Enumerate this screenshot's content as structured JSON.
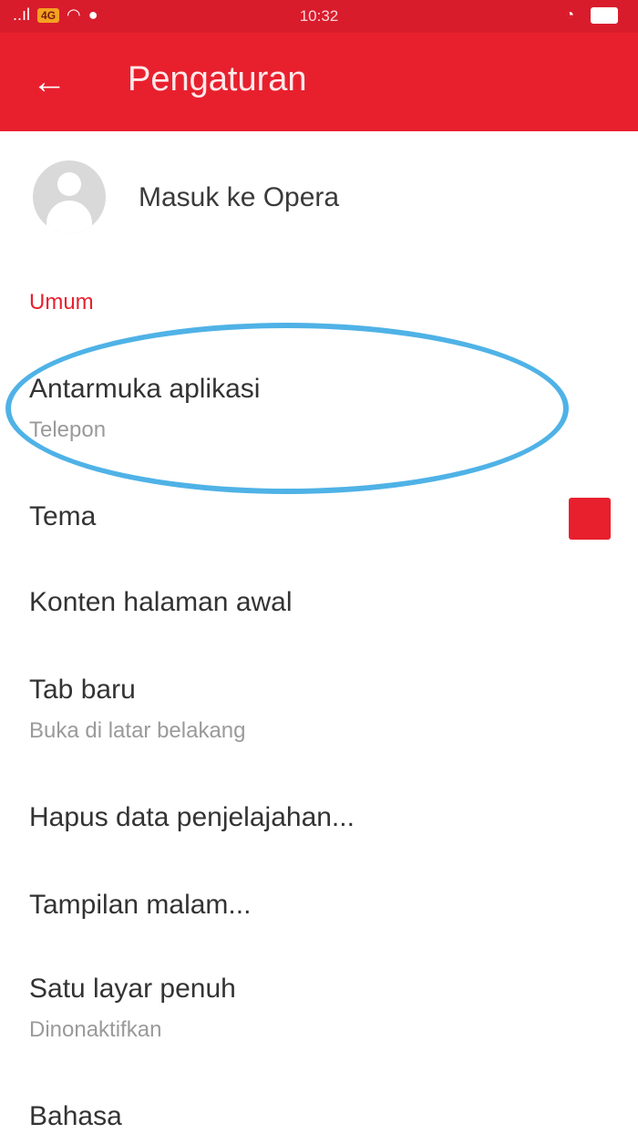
{
  "status_bar": {
    "signal": "..ıl",
    "badge": "4G",
    "time": "10:32"
  },
  "app_bar": {
    "back_glyph": "←",
    "title": "Pengaturan"
  },
  "account": {
    "label": "Masuk ke Opera"
  },
  "section": {
    "header": "Umum"
  },
  "settings": [
    {
      "title": "Antarmuka aplikasi",
      "subtitle": "Telepon"
    },
    {
      "title": "Tema"
    },
    {
      "title": "Konten halaman awal"
    },
    {
      "title": "Tab baru",
      "subtitle": "Buka di latar belakang"
    },
    {
      "title": "Hapus data penjelajahan..."
    },
    {
      "title": "Tampilan malam..."
    },
    {
      "title": "Satu layar penuh",
      "subtitle": "Dinonaktifkan"
    },
    {
      "title": "Bahasa"
    }
  ],
  "colors": {
    "brand": "#e8202e",
    "highlight": "#4fb2e6",
    "theme_swatch": "#e8202e"
  }
}
